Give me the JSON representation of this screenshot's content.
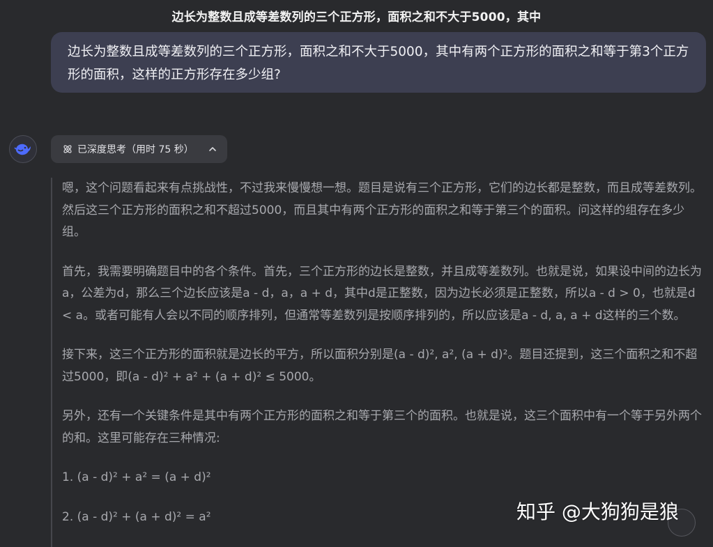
{
  "header": {
    "title": "边长为整数且成等差数列的三个正方形，面积之和不大于5000，其中"
  },
  "user_message": {
    "text": "边长为整数且成等差数列的三个正方形，面积之和不大于5000，其中有两个正方形的面积之和等于第3个正方形的面积，这样的正方形存在多少组?"
  },
  "assistant": {
    "avatar_icon": "whale-logo-icon",
    "thinking_toggle": {
      "icon": "atom-icon",
      "label": "已深度思考（用时 75 秒）",
      "state_icon": "chevron-up-icon"
    },
    "thought_paragraphs": [
      "嗯，这个问题看起来有点挑战性，不过我来慢慢想一想。题目是说有三个正方形，它们的边长都是整数，而且成等差数列。然后这三个正方形的面积之和不超过5000，而且其中有两个正方形的面积之和等于第三个的面积。问这样的组存在多少组。",
      "首先，我需要明确题目中的各个条件。首先，三个正方形的边长是整数，并且成等差数列。也就是说，如果设中间的边长为a，公差为d，那么三个边长应该是a - d，a，a + d，其中d是正整数，因为边长必须是正整数，所以a - d > 0，也就是d < a。或者可能有人会以不同的顺序排列，但通常等差数列是按顺序排列的，所以应该是a - d, a, a + d这样的三个数。",
      "接下来，这三个正方形的面积就是边长的平方，所以面积分别是(a - d)², a², (a + d)²。题目还提到，这三个面积之和不超过5000，即(a - d)² + a² + (a + d)² ≤ 5000。",
      "另外，还有一个关键条件是其中有两个正方形的面积之和等于第三个的面积。也就是说，这三个面积中有一个等于另外两个的和。这里可能存在三种情况:",
      "1. (a - d)² + a² = (a + d)²",
      "2. (a - d)² + (a + d)² = a²"
    ]
  },
  "watermark": {
    "text": "知乎 @大狗狗是狼"
  },
  "colors": {
    "background": "#292a2d",
    "user_bubble": "#3d3f51",
    "toggle_bg": "#3a3b40",
    "thought_text": "#a8a9ae",
    "accent_logo": "#4d6bfe"
  }
}
